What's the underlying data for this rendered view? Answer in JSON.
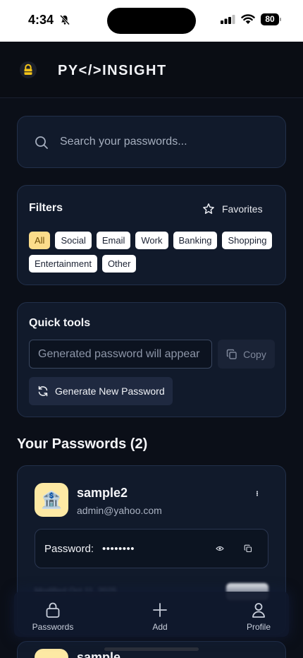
{
  "status_bar": {
    "time": "4:34",
    "battery": "80"
  },
  "header": {
    "title": "PY</>INSIGHT"
  },
  "search": {
    "placeholder": "Search your passwords..."
  },
  "filters": {
    "title": "Filters",
    "favorites_label": "Favorites",
    "chips": [
      "All",
      "Social",
      "Email",
      "Work",
      "Banking",
      "Shopping",
      "Entertainment",
      "Other"
    ],
    "active": "All"
  },
  "quick_tools": {
    "title": "Quick tools",
    "generated_placeholder": "Generated password will appear here",
    "copy_label": "Copy",
    "generate_label": "Generate New Password"
  },
  "passwords_section": {
    "title": "Your Passwords (2)"
  },
  "passwords": [
    {
      "name": "sample2",
      "email": "admin@yahoo.com",
      "password_label": "Password:",
      "masked": "••••••••",
      "icon": "bank-icon",
      "meta": "Modified Oct 11, 2025"
    },
    {
      "name": "sample"
    }
  ],
  "bottom_nav": {
    "passwords": "Passwords",
    "add": "Add",
    "profile": "Profile"
  },
  "colors": {
    "active_chip": "#fbdc8b",
    "avatar_bg": "#fde9a4",
    "card_bg": "#111a2b",
    "page_bg": "#0b0f18"
  }
}
